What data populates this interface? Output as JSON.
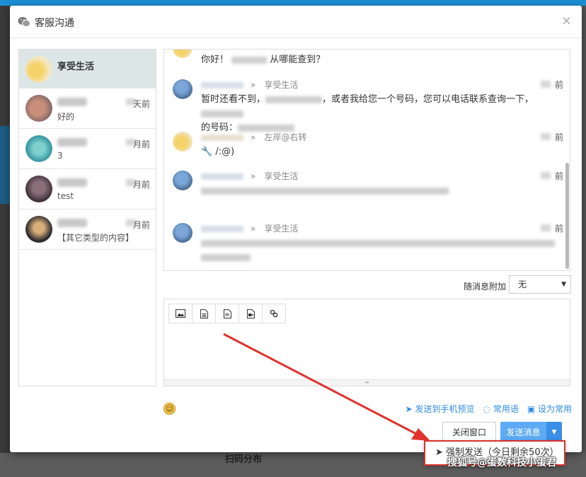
{
  "modal": {
    "title": "客服沟通",
    "close_label": "×"
  },
  "background": {
    "bottom_label": "扫码分布"
  },
  "contacts": [
    {
      "name": "享受生活",
      "preview": "",
      "time": "",
      "active": true
    },
    {
      "name": "",
      "preview": "好的",
      "time": "天前",
      "active": false
    },
    {
      "name": "",
      "preview": "3",
      "time": "月前",
      "active": false
    },
    {
      "name": "",
      "preview": "test",
      "time": "月前",
      "active": false
    },
    {
      "name": "",
      "preview": "【其它类型的内容】",
      "time": "月前",
      "active": false
    }
  ],
  "messages": [
    {
      "sender": "",
      "text_a": "你好！",
      "text_b": "从哪能查到？",
      "time": ""
    },
    {
      "sender": "享受生活",
      "text_a": "暂时还看不到，",
      "text_b": "，或者我给您一个号码，您可以电话联系查询一下，",
      "text_c": "的号码：",
      "time": "前"
    },
    {
      "sender": "左岸@右转",
      "text_a": "🔧 /:@)",
      "time": "前"
    },
    {
      "sender": "享受生活",
      "time": "前"
    },
    {
      "sender": "享受生活",
      "time": "前"
    }
  ],
  "attach": {
    "label": "随消息附加",
    "selected": "无"
  },
  "toolbar": {
    "tools": [
      "image-icon",
      "file-icon",
      "audio-icon",
      "video-icon",
      "link-icon"
    ]
  },
  "links": {
    "preview": "发送到手机预览",
    "phrases": "常用语",
    "set_common": "设为常用"
  },
  "buttons": {
    "close": "关闭窗口",
    "send": "发送消息",
    "force_send": "强制发送（今日剩余50次）"
  },
  "watermark": "搜狐号@蛋数科技小蛋君",
  "colors": {
    "primary": "#5eaaf5",
    "link": "#2f8be2",
    "highlight": "#d9302c"
  }
}
